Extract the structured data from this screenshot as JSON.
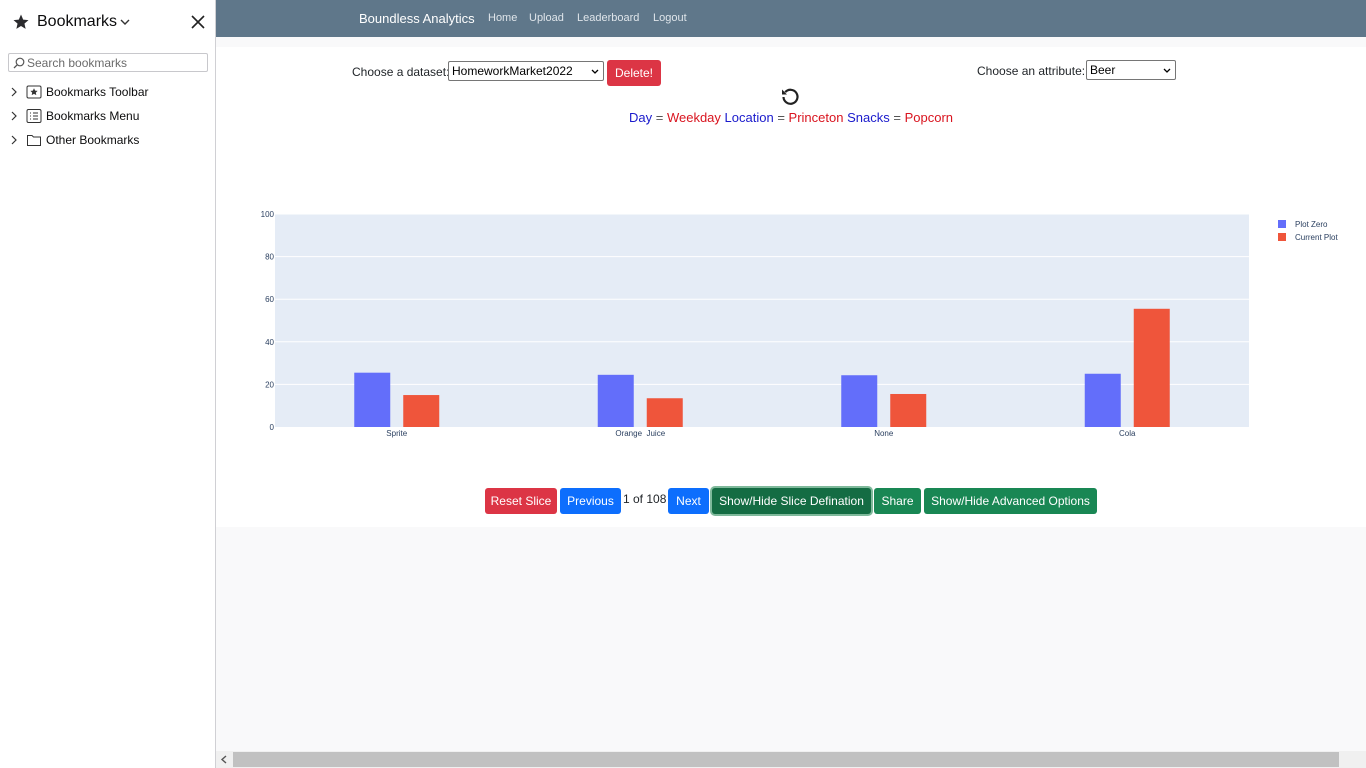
{
  "sidebar": {
    "title": "Bookmarks",
    "search_placeholder": "Search bookmarks",
    "items": [
      {
        "label": "Bookmarks Toolbar",
        "icon": "bookmarks-toolbar-icon"
      },
      {
        "label": "Bookmarks Menu",
        "icon": "bookmarks-menu-icon"
      },
      {
        "label": "Other Bookmarks",
        "icon": "folder-icon"
      }
    ]
  },
  "nav": {
    "brand": "Boundless Analytics",
    "links": [
      "Home",
      "Upload",
      "Leaderboard",
      "Logout"
    ]
  },
  "controls": {
    "dataset_label": "Choose a dataset:",
    "dataset_value": "HomeworkMarket2022",
    "delete_label": "Delete!",
    "attribute_label": "Choose an attribute:",
    "attribute_value": "Beer"
  },
  "slice_definition": [
    {
      "key": "Day",
      "eq": "=",
      "value": "Weekday"
    },
    {
      "key": "Location",
      "eq": "=",
      "value": "Princeton"
    },
    {
      "key": "Snacks",
      "eq": "=",
      "value": "Popcorn"
    }
  ],
  "chart_data": {
    "type": "bar",
    "categories": [
      "Sprite",
      "Orange  Juice",
      "None",
      "Cola"
    ],
    "series": [
      {
        "name": "Plot Zero",
        "values": [
          25.5,
          24.5,
          24.3,
          25
        ],
        "color": "#636efa"
      },
      {
        "name": "Current Plot",
        "values": [
          15,
          13.5,
          15.5,
          55.5
        ],
        "color": "#ef553b"
      }
    ],
    "ylim": [
      0,
      100
    ],
    "yticks": [
      0,
      20,
      40,
      60,
      80,
      100
    ],
    "grid": true,
    "legend": "top-right",
    "plot_bg": "#e5ecf6"
  },
  "buttons": {
    "reset": "Reset Slice",
    "previous": "Previous",
    "pager": "1 of 108",
    "next": "Next",
    "toggle_slice": "Show/Hide Slice Defination",
    "share": "Share",
    "toggle_advanced": "Show/Hide Advanced Options"
  }
}
